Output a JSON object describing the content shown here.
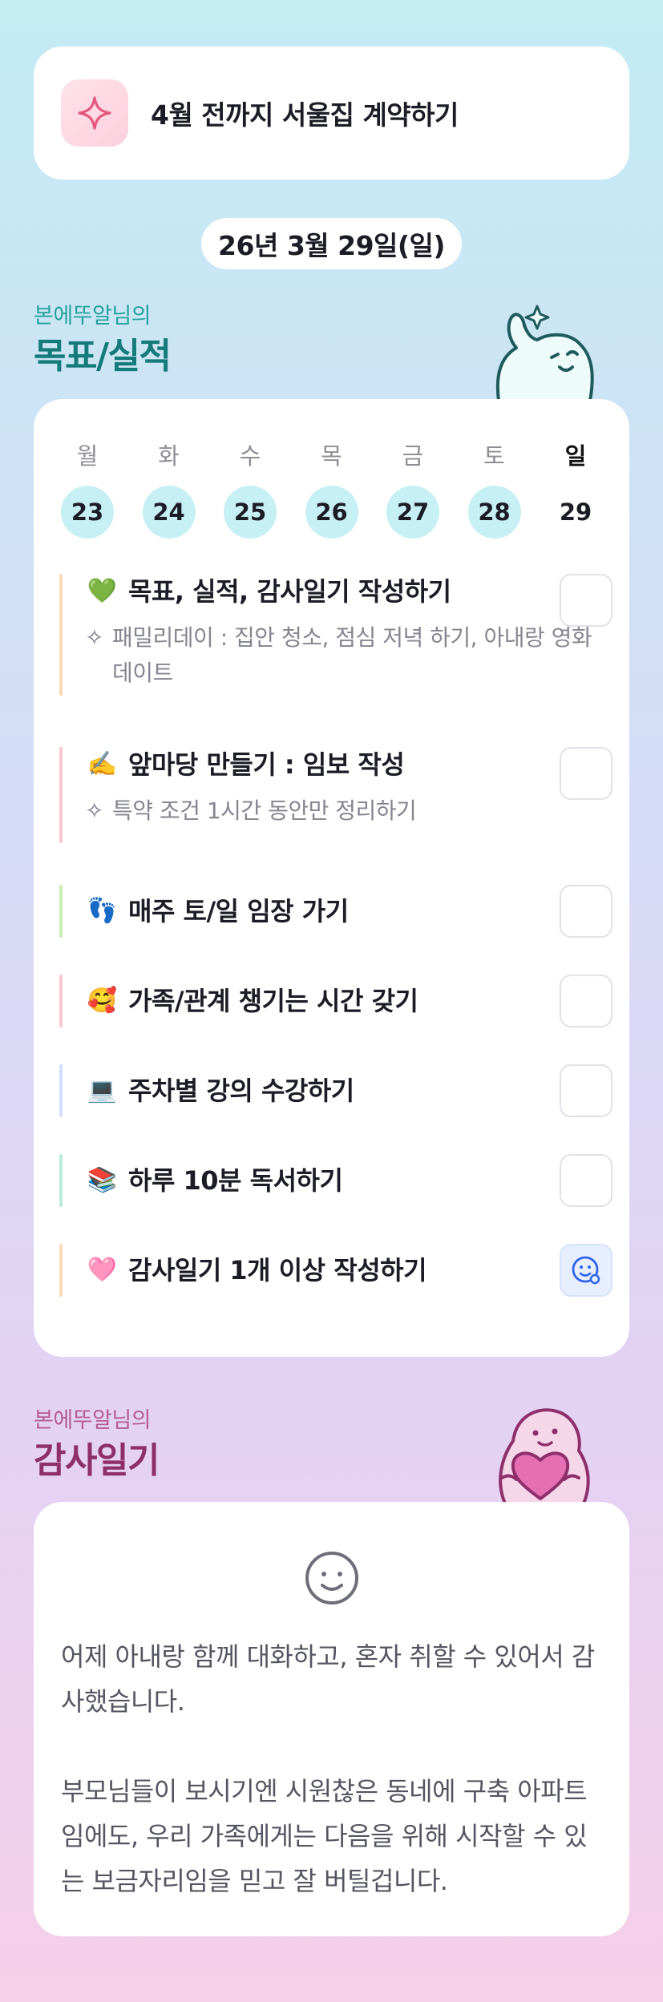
{
  "goal": {
    "text": "4월 전까지 서울집 계약하기",
    "icon": "sparkle-icon"
  },
  "date": "26년 3월 29일(일)",
  "goals_section": {
    "subtitle": "본에뚜알님의",
    "title": "목표/실적"
  },
  "week": {
    "days": [
      {
        "label": "월",
        "num": "23"
      },
      {
        "label": "화",
        "num": "24"
      },
      {
        "label": "수",
        "num": "25"
      },
      {
        "label": "목",
        "num": "26"
      },
      {
        "label": "금",
        "num": "27"
      },
      {
        "label": "토",
        "num": "28"
      },
      {
        "label": "일",
        "num": "29"
      }
    ]
  },
  "tasks": [
    {
      "emoji": "💚",
      "title": "목표, 실적, 감사일기 작성하기",
      "note": "패밀리데이 : 집안 청소, 점심 저녁 하기, 아내랑 영화 데이트",
      "color": "#f9d9b8",
      "checked": false
    },
    {
      "emoji": "✍️",
      "title": "앞마당 만들기 : 임보 작성",
      "note": "특약 조건 1시간 동안만 정리하기",
      "color": "#f8c9cf",
      "checked": false
    },
    {
      "emoji": "👣",
      "title": "매주 토/일 임장 가기",
      "note": "",
      "color": "#cdeeb3",
      "checked": false
    },
    {
      "emoji": "🥰",
      "title": "가족/관계 챙기는 시간 갖기",
      "note": "",
      "color": "#f8c9cf",
      "checked": false
    },
    {
      "emoji": "💻",
      "title": "주차별 강의 수강하기",
      "note": "",
      "color": "#d3dffb",
      "checked": false
    },
    {
      "emoji": "📚",
      "title": "하루 10분 독서하기",
      "note": "",
      "color": "#b9ecd6",
      "checked": false
    },
    {
      "emoji": "🩷",
      "title": "감사일기 1개 이상 작성하기",
      "note": "",
      "color": "#f9d9b8",
      "checked": true
    }
  ],
  "thanks_section": {
    "subtitle": "본에뚜알님의",
    "title": "감사일기"
  },
  "thanks": {
    "icon": "smile-icon",
    "paragraphs": [
      "어제 아내랑 함께 대화하고, 혼자 취할 수 있어서 감사했습니다.",
      "부모님들이 보시기엔 시원찮은 동네에 구축 아파트임에도, 우리 가족에게는 다음을 위해 시작할 수 있는 보금자리임을 믿고 잘 버틸겁니다."
    ]
  }
}
